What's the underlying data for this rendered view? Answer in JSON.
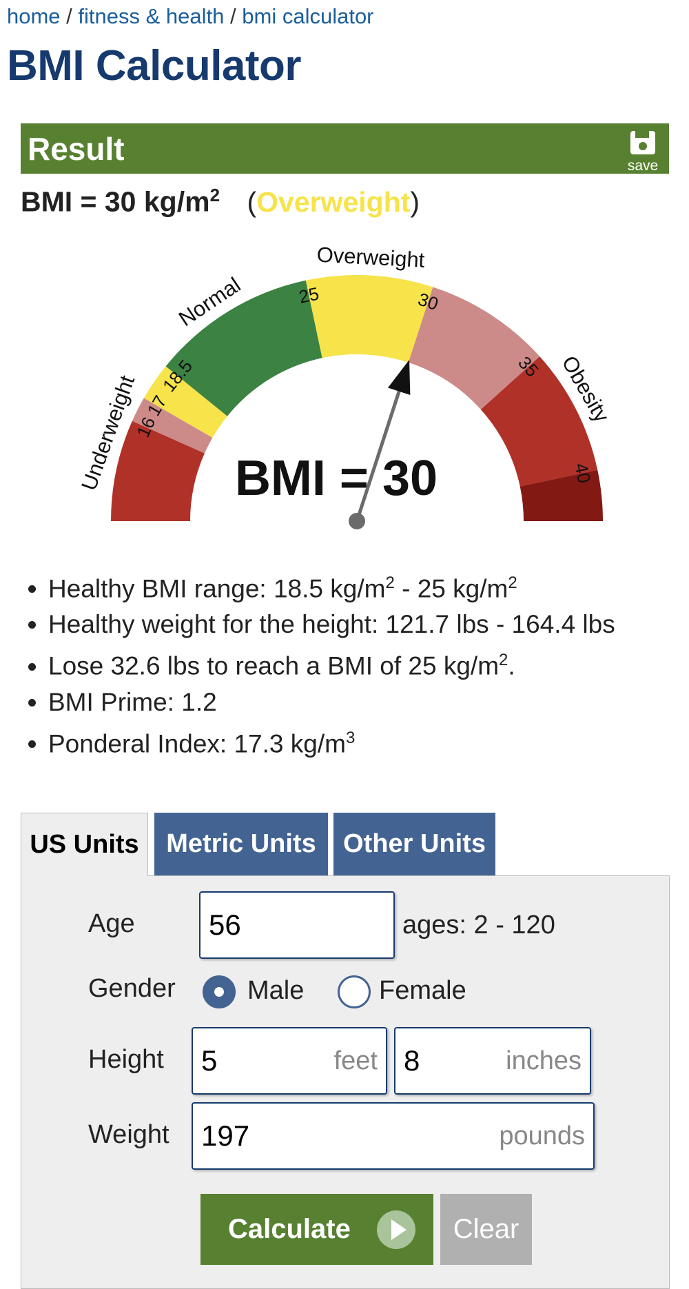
{
  "breadcrumb": {
    "home": "home",
    "category": "fitness & health",
    "current": "bmi calculator",
    "separator": "/"
  },
  "page_title": "BMI Calculator",
  "result": {
    "title": "Result",
    "save_label": "save",
    "save_icon": "floppy-disk-icon",
    "bmi_prefix": "BMI = 30 kg/m",
    "bmi_exponent": "2",
    "category_open": "(",
    "category": "Overweight",
    "category_close": ")",
    "category_color": "#f7e34a"
  },
  "gauge": {
    "value": 30,
    "value_text": "BMI = 30",
    "min": 12,
    "max": 42,
    "segment_labels": {
      "underweight": "Underweight",
      "normal": "Normal",
      "overweight": "Overweight",
      "obesity": "Obesity"
    },
    "ticks": [
      "16",
      "17",
      "18.5",
      "25",
      "30",
      "35",
      "40"
    ],
    "colors": {
      "severe": "#b03128",
      "mild_under": "#cc8a89",
      "slight_under": "#f7e34a",
      "normal": "#3b8243",
      "overweight": "#f7e34a",
      "obese1": "#cc8a89",
      "obese2": "#b03128",
      "obese3": "#831913",
      "needle": "#6b6b6b"
    }
  },
  "stats": [
    {
      "text": "Healthy BMI range: 18.5 kg/m",
      "sup": "2",
      "tail": " - 25 kg/m",
      "sup2": "2",
      "end": ""
    },
    {
      "text": "Healthy weight for the height: 121.7 lbs - 164.4 lbs",
      "sup": "",
      "tail": "",
      "sup2": "",
      "end": ""
    },
    {
      "text": "Lose 32.6 lbs to reach a BMI of 25 kg/m",
      "sup": "2",
      "tail": "",
      "sup2": "",
      "end": "."
    },
    {
      "text": "BMI Prime: 1.2",
      "sup": "",
      "tail": "",
      "sup2": "",
      "end": ""
    },
    {
      "text": "Ponderal Index: 17.3 kg/m",
      "sup": "3",
      "tail": "",
      "sup2": "",
      "end": ""
    }
  ],
  "tabs": [
    {
      "label": "US Units",
      "active": true
    },
    {
      "label": "Metric Units",
      "active": false
    },
    {
      "label": "Other Units",
      "active": false
    }
  ],
  "form": {
    "age": {
      "label": "Age",
      "value": "56",
      "hint": "ages: 2 - 120"
    },
    "gender": {
      "label": "Gender",
      "male": "Male",
      "female": "Female",
      "selected": "Male"
    },
    "height": {
      "label": "Height",
      "feet_value": "5",
      "feet_unit": "feet",
      "inches_value": "8",
      "inches_unit": "inches"
    },
    "weight": {
      "label": "Weight",
      "value": "197",
      "unit": "pounds"
    },
    "calculate_label": "Calculate",
    "clear_label": "Clear"
  }
}
